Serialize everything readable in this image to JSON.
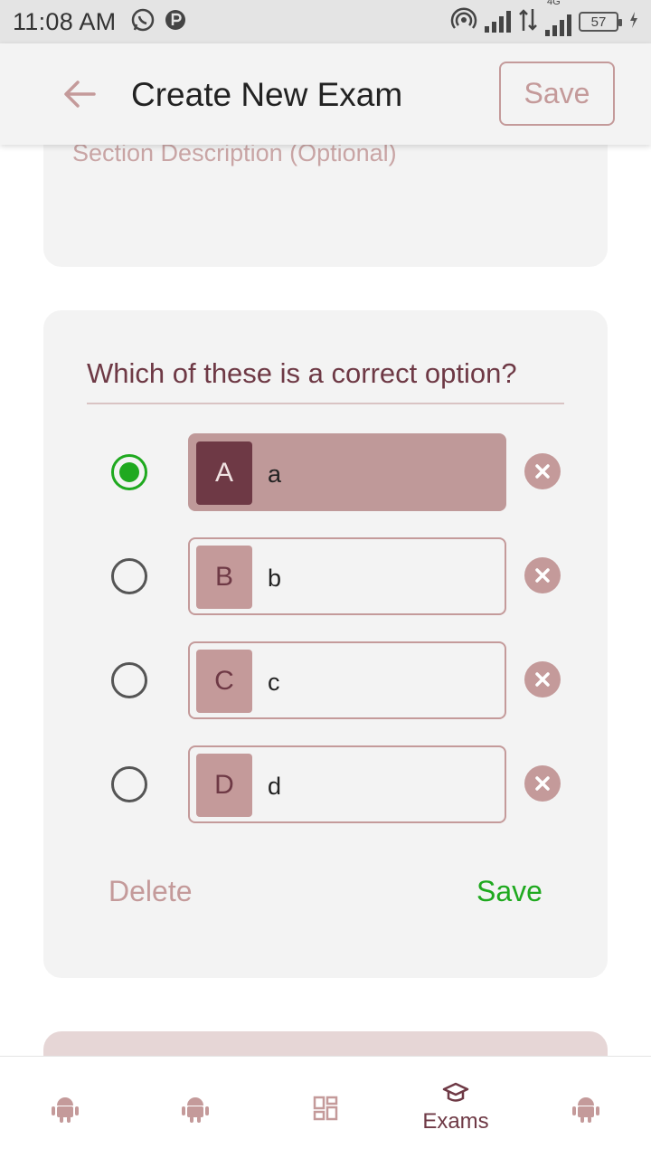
{
  "status_bar": {
    "time": "11:08 AM",
    "network": "4G",
    "battery": "57"
  },
  "app_bar": {
    "title": "Create New Exam",
    "save_label": "Save"
  },
  "section": {
    "description_placeholder": "Section Description (Optional)"
  },
  "question": {
    "text": "Which of these is a correct option?",
    "options": [
      {
        "letter": "A",
        "text": "a",
        "selected": true
      },
      {
        "letter": "B",
        "text": "b",
        "selected": false
      },
      {
        "letter": "C",
        "text": "c",
        "selected": false
      },
      {
        "letter": "D",
        "text": "d",
        "selected": false
      }
    ],
    "delete_label": "Delete",
    "save_label": "Save"
  },
  "bottom_nav": {
    "items": [
      {
        "icon": "android-icon",
        "label": ""
      },
      {
        "icon": "android-icon",
        "label": ""
      },
      {
        "icon": "dashboard-icon",
        "label": ""
      },
      {
        "icon": "graduation-cap-icon",
        "label": "Exams"
      },
      {
        "icon": "android-icon",
        "label": ""
      }
    ]
  },
  "colors": {
    "accent": "#6e3945",
    "muted": "#c49a9a",
    "selected_option": "#bf9999",
    "success": "#1fa91f",
    "card": "#f3f3f3"
  }
}
